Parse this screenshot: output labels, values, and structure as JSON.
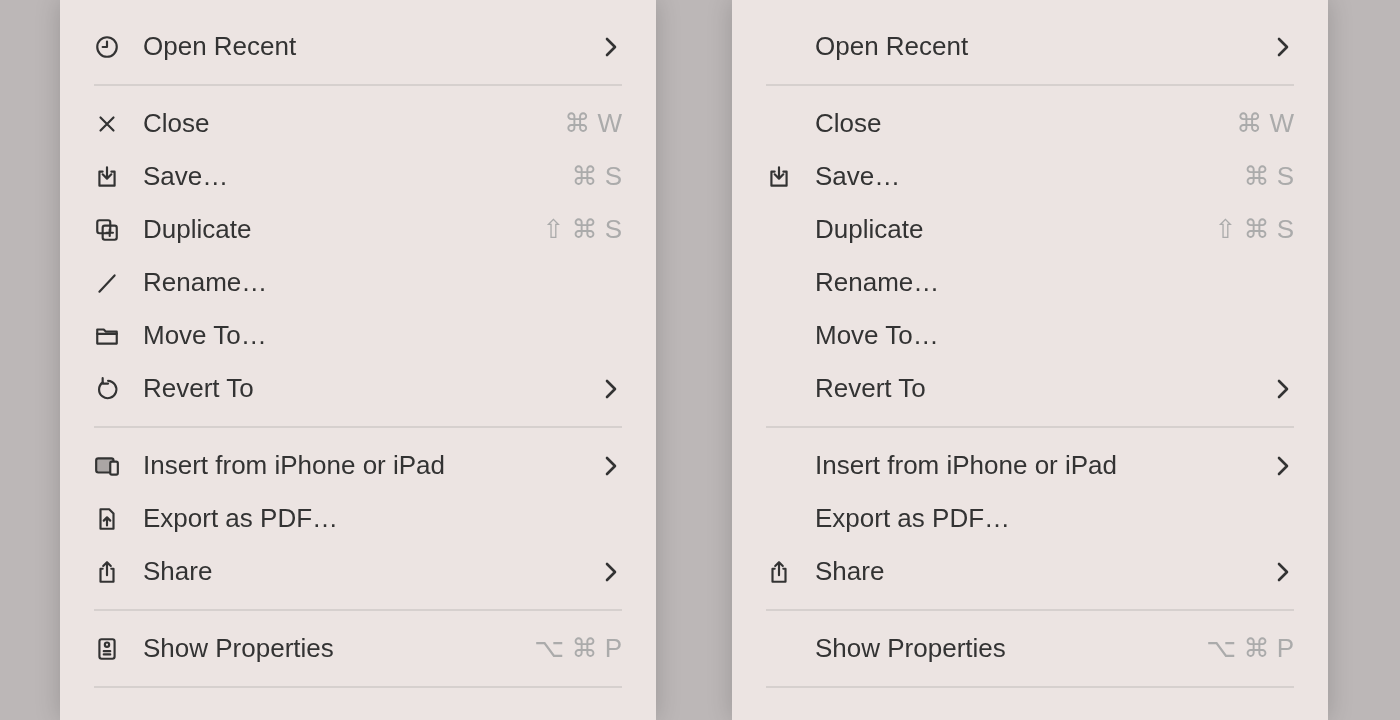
{
  "menus": [
    {
      "items": [
        {
          "kind": "icon_item",
          "label": "Open Recent",
          "submenu": true
        },
        {
          "kind": "separator"
        },
        {
          "kind": "icon_item",
          "label": "Close",
          "shortcut": "⌘ W",
          "submenu": false
        },
        {
          "kind": "icon_item",
          "label": "Save…",
          "shortcut": "⌘ S",
          "submenu": false
        },
        {
          "kind": "icon_item",
          "label": "Duplicate",
          "shortcut": "⇧ ⌘ S",
          "submenu": false
        },
        {
          "kind": "icon_item",
          "label": "Rename…",
          "submenu": false
        },
        {
          "kind": "icon_item",
          "label": "Move To…",
          "submenu": false
        },
        {
          "kind": "icon_item",
          "label": "Revert To",
          "submenu": true
        },
        {
          "kind": "separator"
        },
        {
          "kind": "icon_item",
          "label": "Insert from iPhone or iPad",
          "submenu": true
        },
        {
          "kind": "icon_item",
          "label": "Export as PDF…",
          "submenu": false
        },
        {
          "kind": "icon_item",
          "label": "Share",
          "submenu": true
        },
        {
          "kind": "separator"
        },
        {
          "kind": "icon_item",
          "label": "Show Properties",
          "shortcut": "⌥ ⌘ P",
          "submenu": false
        },
        {
          "kind": "separator"
        }
      ]
    },
    {
      "items": [
        {
          "kind": "item",
          "label": "Open Recent",
          "submenu": true
        },
        {
          "kind": "separator"
        },
        {
          "kind": "item",
          "label": "Close",
          "shortcut": "⌘ W",
          "submenu": false
        },
        {
          "kind": "icon_item",
          "label": "Save…",
          "shortcut": "⌘ S",
          "submenu": false
        },
        {
          "kind": "item",
          "label": "Duplicate",
          "shortcut": "⇧ ⌘ S",
          "submenu": false
        },
        {
          "kind": "item",
          "label": "Rename…",
          "submenu": false
        },
        {
          "kind": "item",
          "label": "Move To…",
          "submenu": false
        },
        {
          "kind": "item",
          "label": "Revert To",
          "submenu": true
        },
        {
          "kind": "separator"
        },
        {
          "kind": "item",
          "label": "Insert from iPhone or iPad",
          "submenu": true
        },
        {
          "kind": "item",
          "label": "Export as PDF…",
          "submenu": false
        },
        {
          "kind": "icon_item",
          "label": "Share",
          "submenu": true
        },
        {
          "kind": "separator"
        },
        {
          "kind": "item",
          "label": "Show Properties",
          "shortcut": "⌥ ⌘ P",
          "submenu": false
        },
        {
          "kind": "separator"
        }
      ]
    }
  ]
}
